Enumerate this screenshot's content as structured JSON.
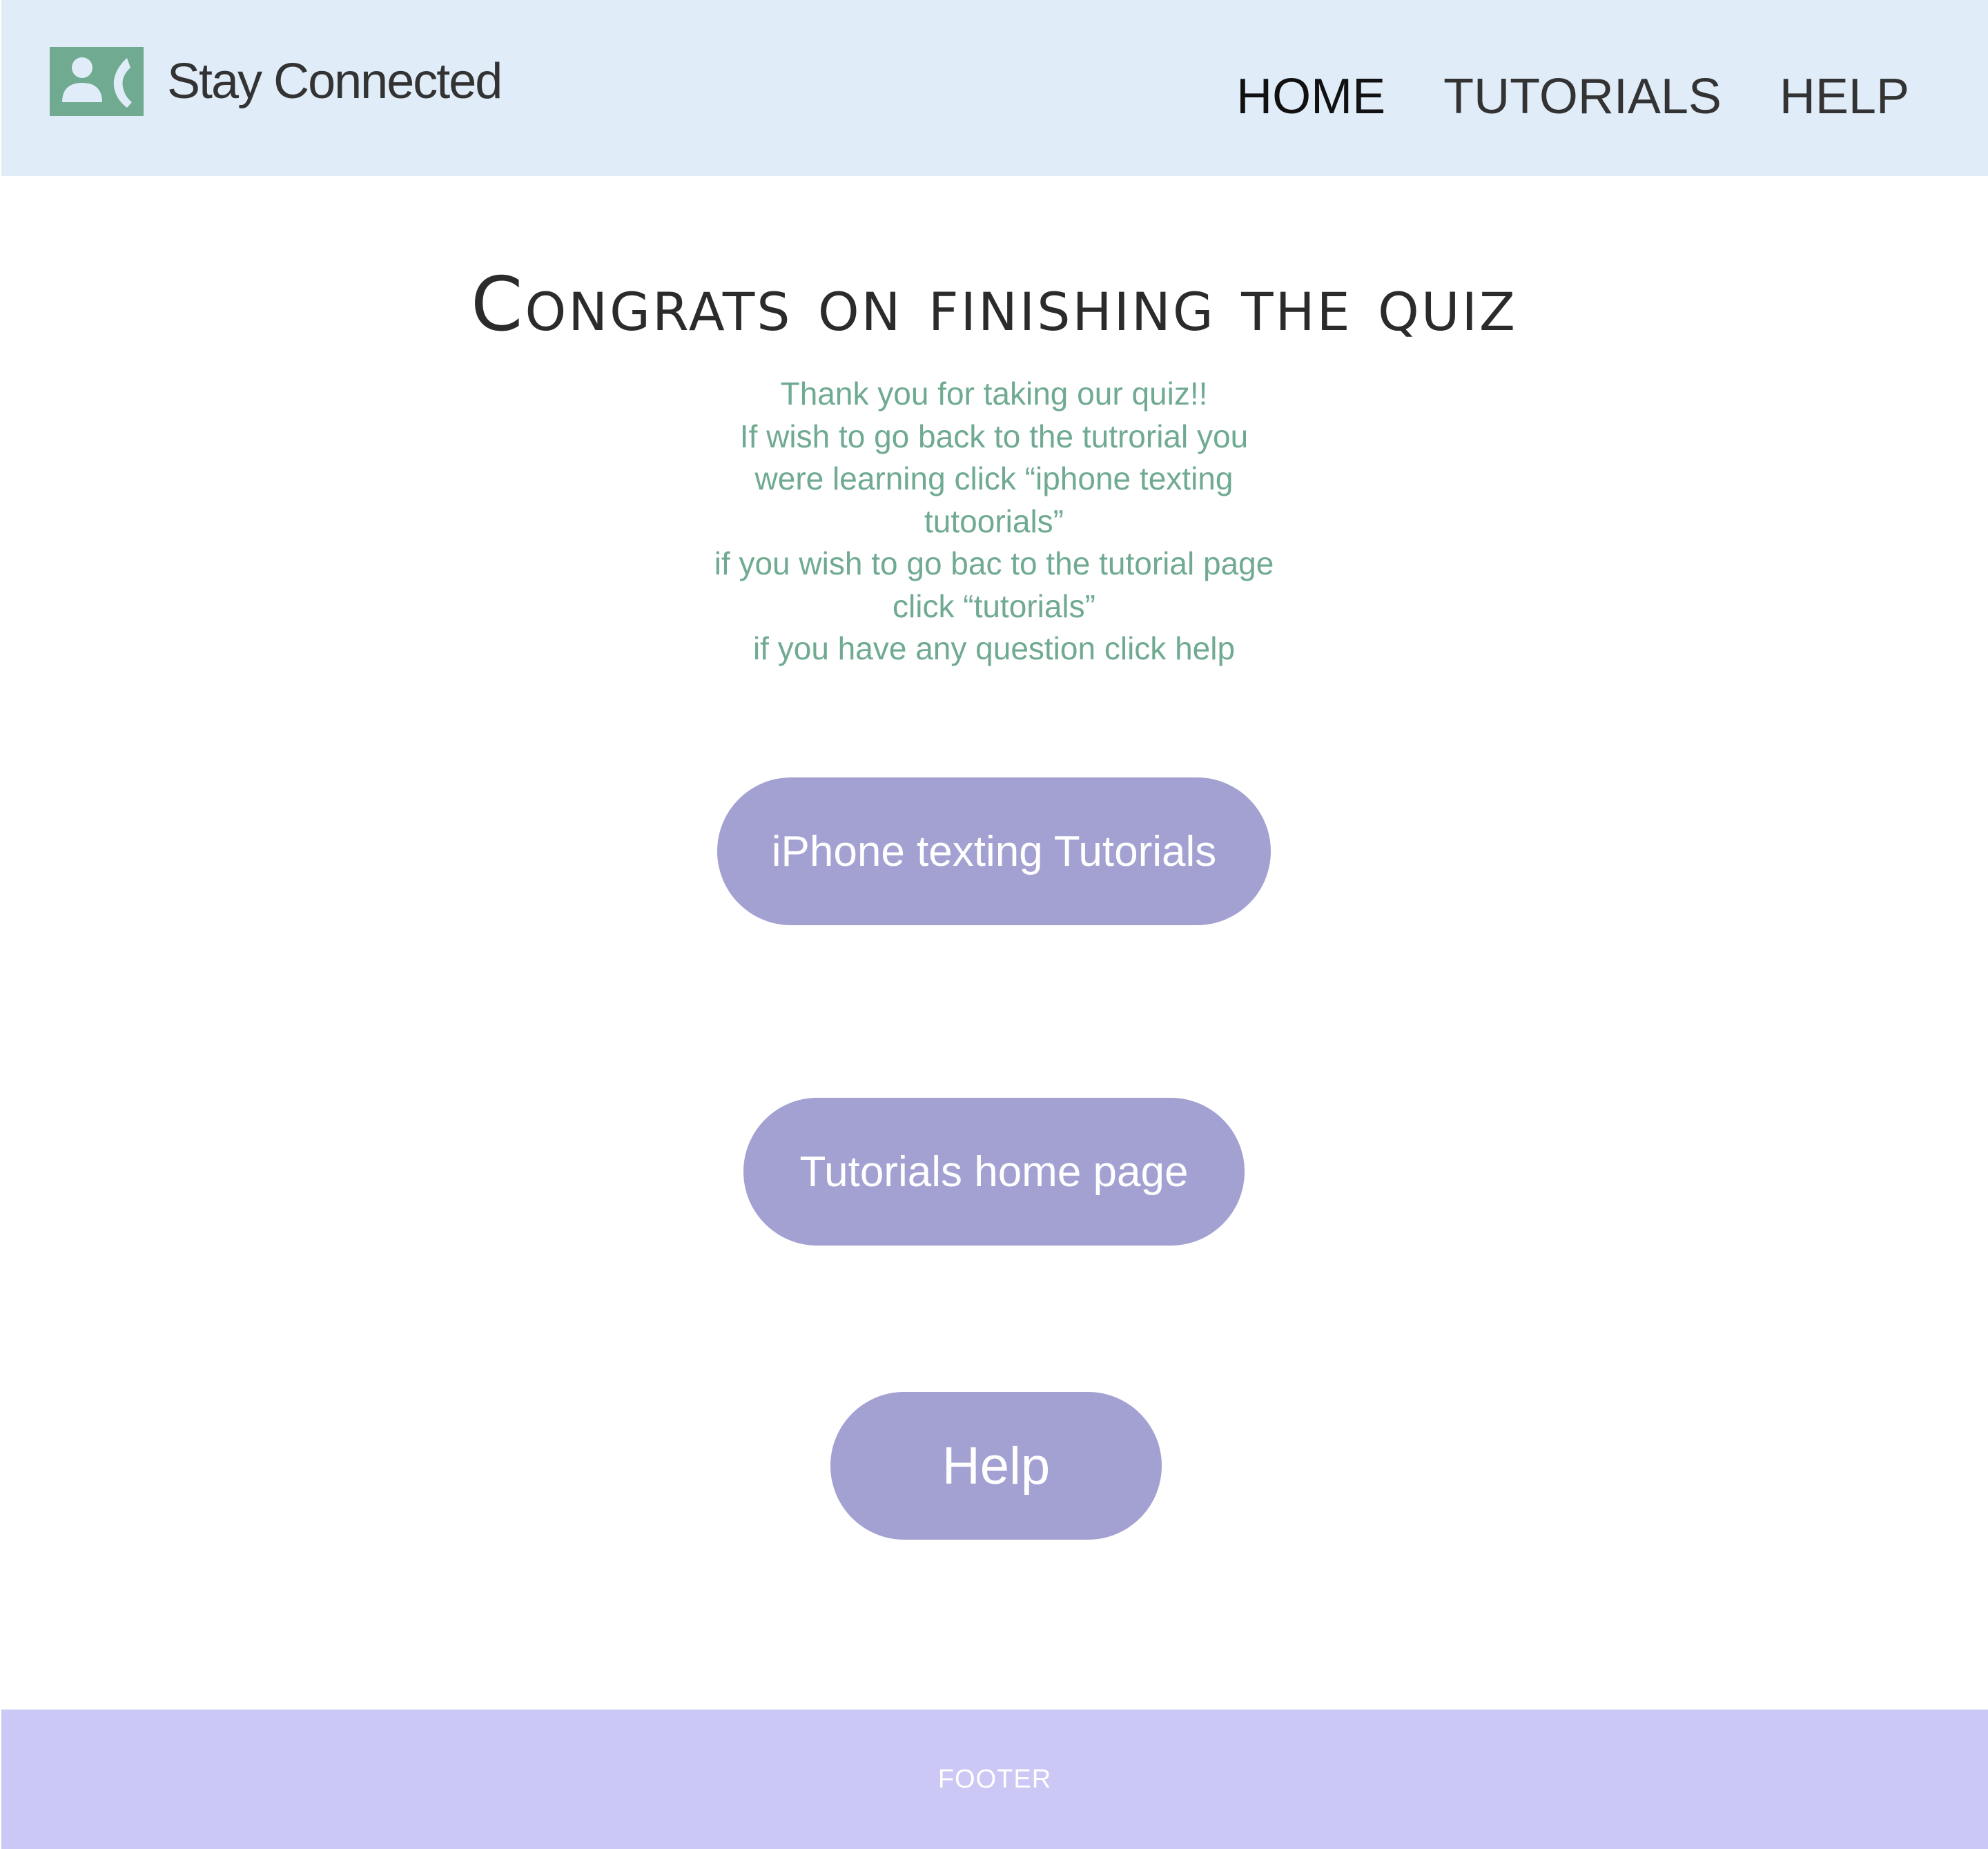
{
  "header": {
    "brand_name": "Stay Connected",
    "logo_icon": "contact-phone-icon",
    "nav": [
      {
        "label": "HOME",
        "active": true
      },
      {
        "label": "TUTORIALS",
        "active": false
      },
      {
        "label": "HELP",
        "active": false
      }
    ]
  },
  "main": {
    "title": "Congrats on finishing the quiz",
    "message_lines": [
      "Thank you for taking our quiz!!",
      "If wish to go back to the tutrorial you",
      "were learning click “iphone texting",
      "tutoorials”",
      "if you wish to go bac to the tutorial page",
      "click “tutorials”",
      "if you have any question click help"
    ],
    "buttons": {
      "iphone_tutorials": "iPhone texting Tutorials",
      "tutorials_home": "Tutorials home page",
      "help": "Help"
    }
  },
  "footer": {
    "label": "FOOTER"
  },
  "colors": {
    "header_bg": "#e0ecf8",
    "accent_green": "#6faa91",
    "button_bg": "#a3a1d2",
    "footer_bg": "#cbc8f5"
  }
}
